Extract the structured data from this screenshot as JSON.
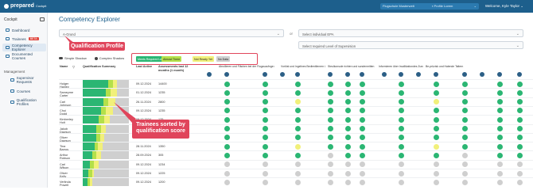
{
  "app": {
    "logo_text": "prepared",
    "logo_sub": "Cockpit",
    "org_select": "Flugschule Musterwelt",
    "profile_select": "Profile Lorem",
    "welcome": "Welcome, Kyle Taylor"
  },
  "sidebar": {
    "header": "Cockpit",
    "items": [
      {
        "label": "Dashboard",
        "icon": "dashboard-icon"
      },
      {
        "label": "Trainees",
        "icon": "trainees-icon",
        "badge": "BETA"
      },
      {
        "label": "Competency Explorer",
        "icon": "explorer-icon",
        "active": true
      },
      {
        "label": "Documented Courses",
        "icon": "courses-icon"
      }
    ],
    "group_label": "Management",
    "mgmt_items": [
      {
        "label": "Supervisor Requests",
        "icon": "supervisor-icon"
      },
      {
        "label": "Courses",
        "icon": "course-icon"
      },
      {
        "label": "Qualification Profiles",
        "icon": "profile-icon"
      }
    ]
  },
  "main": {
    "title": "Competency Explorer",
    "filter_profile": "A-Grund",
    "or_label": "or",
    "filter_epa": "Select individual EPA",
    "filter_supervision": "Select required Level of Supervision",
    "toggles": [
      "Simple Shadow",
      "Complex Shadow"
    ],
    "legend": [
      {
        "label": "Meets Required Level",
        "color": "#2bb673",
        "text": "#ffffff"
      },
      {
        "label": "Almost There",
        "color": "#b4e04a",
        "text": "#222222"
      },
      {
        "label": "Not Ready Yet",
        "color": "#f1f07a",
        "text": "#222222"
      },
      {
        "label": "No Data",
        "color": "#cfcfcf",
        "text": "#222222"
      }
    ],
    "callout_profile": "Qualification Profile",
    "callout_trainees": "Trainees sorted by qualification score",
    "columns": {
      "name": "Name",
      "summary": "Qualification Summary",
      "last_active": "Last Active",
      "hours": "Assessments last 12 months (1 month)"
    },
    "epa_headers": [
      "Abrollieren und Flächen bei der Flugzuaufnge rechtzeitinen",
      "Vorlöst und Ingelines Bedientlienern überfühnen",
      "Steulkonsole richten und sundenmitten",
      "Informieren über Inudlikationdes Zunden richten und sundierben",
      "Be-prüzisk und Halende Taltern"
    ],
    "rows": [
      {
        "name": "Holger Hanley",
        "date": "09.12.2024",
        "hours": "14400",
        "bar": [
          0.55,
          0.1,
          0.1,
          0.25
        ],
        "dots": [
          "g",
          "g",
          "g",
          "g",
          "g"
        ]
      },
      {
        "name": "Sameyme Carter",
        "date": "01.12.2024",
        "hours": "1235",
        "bar": [
          0.5,
          0.1,
          0.15,
          0.25
        ],
        "dots": [
          "g",
          "g",
          "g",
          "g",
          "g"
        ]
      },
      {
        "name": "Carl Johnson",
        "date": "26.11.2024",
        "hours": "2800",
        "bar": [
          0.45,
          0.1,
          0.15,
          0.3
        ],
        "dots": [
          "g",
          "g",
          "y",
          "g",
          "g"
        ]
      },
      {
        "name": "Chui Dodd",
        "date": "09.12.2024",
        "hours": "1235",
        "bar": [
          0.4,
          0.1,
          0.15,
          0.35
        ],
        "dots": [
          "g",
          "g",
          "g",
          "g",
          "g"
        ]
      },
      {
        "name": "Kimberley Holt",
        "date": "09.12.2024",
        "hours": "125",
        "bar": [
          0.35,
          0.12,
          0.12,
          0.41
        ],
        "dots": [
          "g",
          "g",
          "g",
          "g",
          "g"
        ]
      },
      {
        "name": "Jakob Dawson",
        "date": "09.12.2024",
        "hours": "1234",
        "bar": [
          0.3,
          0.1,
          0.1,
          0.5
        ],
        "dots": [
          "g",
          "g",
          "g",
          "g",
          "g"
        ]
      },
      {
        "name": "Oliver Dawson",
        "date": "09.12.2024",
        "hours": "900",
        "bar": [
          0.3,
          0.08,
          0.08,
          0.54
        ],
        "dots": [
          "g",
          "g",
          "g",
          "g",
          "g"
        ]
      },
      {
        "name": "Tina Barros",
        "date": "28.11.2024",
        "hours": "1350",
        "bar": [
          0.25,
          0.08,
          0.1,
          0.57
        ],
        "dots": [
          "g",
          "g",
          "y",
          "g",
          "g"
        ]
      },
      {
        "name": "Arthur Robson",
        "date": "28.09.2024",
        "hours": "305",
        "bar": [
          0.2,
          0.1,
          0.1,
          0.6
        ],
        "dots": [
          "g",
          "g",
          "g",
          "n",
          "g"
        ]
      },
      {
        "name": "Carl Wilson",
        "date": "09.12.2024",
        "hours": "1234",
        "bar": [
          0.15,
          0.1,
          0.1,
          0.65
        ],
        "dots": [
          "n",
          "n",
          "n",
          "n",
          "n"
        ]
      },
      {
        "name": "Oliver Kelly",
        "date": "09.12.2024",
        "hours": "1225",
        "bar": [
          0.12,
          0.08,
          0.05,
          0.75
        ],
        "dots": [
          "n",
          "n",
          "n",
          "n",
          "n"
        ]
      },
      {
        "name": "Verlinda Powell",
        "date": "09.12.2024",
        "hours": "1200",
        "bar": [
          0.1,
          0.05,
          0.05,
          0.8
        ],
        "dots": [
          "n",
          "n",
          "n",
          "n",
          "n"
        ]
      }
    ]
  }
}
